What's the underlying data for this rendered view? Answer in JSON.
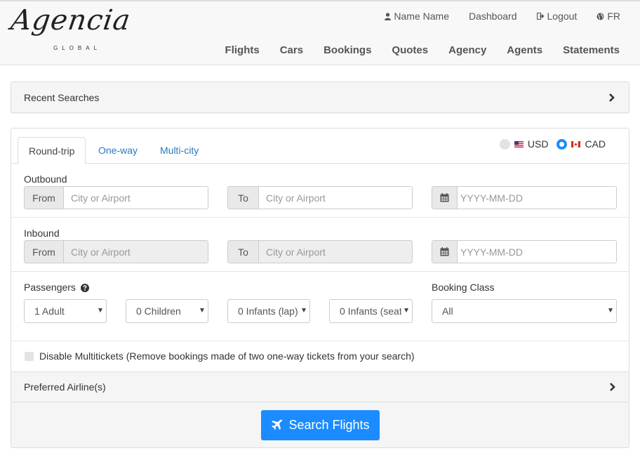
{
  "header": {
    "logo_script": "Agencia",
    "logo_sub": "GLOBAL",
    "top_links": {
      "user": "Name Name",
      "dashboard": "Dashboard",
      "logout": "Logout",
      "language": "FR"
    },
    "nav": {
      "flights": "Flights",
      "cars": "Cars",
      "bookings": "Bookings",
      "quotes": "Quotes",
      "agency": "Agency",
      "agents": "Agents",
      "statements": "Statements"
    }
  },
  "recent_searches": {
    "label": "Recent Searches"
  },
  "search": {
    "tabs": {
      "round_trip": "Round-trip",
      "one_way": "One-way",
      "multi_city": "Multi-city"
    },
    "currency": {
      "usd": "USD",
      "cad": "CAD",
      "selected": "CAD"
    },
    "outbound": {
      "label": "Outbound",
      "from_addon": "From",
      "from_placeholder": "City or Airport",
      "to_addon": "To",
      "to_placeholder": "City or Airport",
      "date_placeholder": "YYYY-MM-DD"
    },
    "inbound": {
      "label": "Inbound",
      "from_addon": "From",
      "from_placeholder": "City or Airport",
      "to_addon": "To",
      "to_placeholder": "City or Airport",
      "date_placeholder": "YYYY-MM-DD"
    },
    "passengers": {
      "label": "Passengers",
      "adults": "1 Adult",
      "children": "0 Children",
      "infants_lap": "0 Infants (lap)",
      "infants_seat": "0 Infants (seat)"
    },
    "booking_class": {
      "label": "Booking Class",
      "value": "All"
    },
    "multitickets": {
      "label": "Disable Multitickets (Remove bookings made of two one-way tickets from your search)",
      "checked": false
    },
    "preferred_airlines": {
      "label": "Preferred Airline(s)"
    },
    "submit_label": "Search Flights"
  },
  "colors": {
    "primary": "#1a8cff",
    "link": "#2a7ac2",
    "panel_bg": "#f5f5f5"
  }
}
